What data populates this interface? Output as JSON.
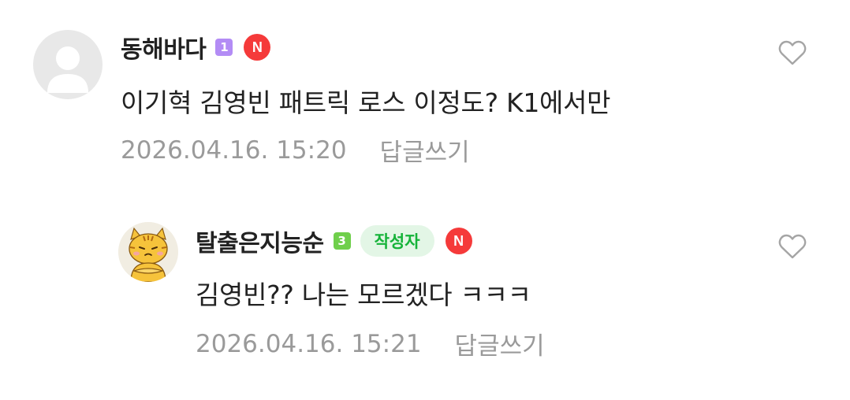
{
  "colors": {
    "level_purple": "#b38cf5",
    "level_green": "#6fcf4b",
    "naver_red": "#f53a3a",
    "author_bg": "#e3f6e6",
    "author_text": "#15b339",
    "meta_gray": "#9a9a9a",
    "text": "#222222"
  },
  "comments": [
    {
      "author": "동해바다",
      "level": "1",
      "badge": "N",
      "text": "이기혁 김영빈 패트릭 로스 이정도? K1에서만",
      "date": "2026.04.16. 15:20",
      "reply_label": "답글쓰기",
      "like_icon": "heart-outline-icon",
      "avatar": "default-profile-icon"
    },
    {
      "author": "탈출은지능순",
      "level": "3",
      "badge": "N",
      "author_tag": "작성자",
      "text": "김영빈?? 나는 모르겠다 ㅋㅋㅋ",
      "date": "2026.04.16. 15:21",
      "reply_label": "답글쓰기",
      "like_icon": "heart-outline-icon",
      "avatar": "tiger-profile-icon"
    }
  ]
}
